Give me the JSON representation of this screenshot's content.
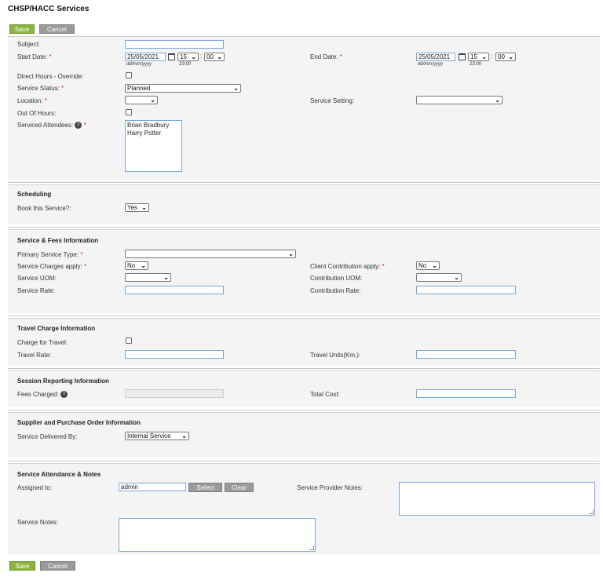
{
  "page": {
    "title": "CHSP/HACC Services"
  },
  "buttons": {
    "save": "Save",
    "cancel": "Cancel",
    "select": "Select",
    "clear": "Clear"
  },
  "required_mark": "*",
  "main": {
    "subject_label": "Subject:",
    "subject_value": "",
    "start_date_label": "Start Date:",
    "start_date_value": "25/05/2021",
    "start_hour": "15",
    "start_minute": "00",
    "date_hint": "dd/mm/yyyy",
    "time_hint": "23:00",
    "time_sep": ":",
    "end_date_label": "End Date:",
    "end_date_value": "25/05/2021",
    "end_hour": "15",
    "end_minute": "00",
    "direct_hours_label": "Direct Hours - Override:",
    "service_status_label": "Service Status:",
    "service_status_value": "Planned",
    "location_label": "Location:",
    "location_value": "",
    "service_setting_label": "Service Setting:",
    "service_setting_value": "",
    "out_of_hours_label": "Out Of Hours:",
    "serviced_attendees_label": "Serviced Attendees:",
    "attendees": [
      "Brian Bradbury",
      "Harry Potter"
    ]
  },
  "scheduling": {
    "title": "Scheduling",
    "book_label": "Book this Service?:",
    "book_value": "Yes"
  },
  "fees": {
    "title": "Service & Fees Information",
    "primary_type_label": "Primary Service Type:",
    "primary_type_value": "",
    "charges_label": "Service Charges apply:",
    "charges_value": "No",
    "client_contrib_label": "Client Contribution apply:",
    "client_contrib_value": "No",
    "uom_label": "Service UOM:",
    "uom_value": "",
    "contrib_uom_label": "Contribution UOM:",
    "contrib_uom_value": "",
    "rate_label": "Service Rate:",
    "rate_value": "",
    "contrib_rate_label": "Contribution Rate:",
    "contrib_rate_value": ""
  },
  "travel": {
    "title": "Travel Charge Information",
    "charge_label": "Charge for Travel:",
    "rate_label": "Travel Rate:",
    "rate_value": "",
    "units_label": "Travel Units(Km.):",
    "units_value": ""
  },
  "session": {
    "title": "Session Reporting Information",
    "fees_label": "Fees Charged:",
    "fees_value": "",
    "total_label": "Total Cost:",
    "total_value": ""
  },
  "supplier": {
    "title": "Supplier and Purchase Order Information",
    "delivered_label": "Service Delivered By:",
    "delivered_value": "Internal Service"
  },
  "attendance": {
    "title": "Service Attendance & Notes",
    "assigned_label": "Assigned to:",
    "assigned_value": "admin",
    "provider_notes_label": "Service Provider Notes:",
    "service_notes_label": "Service Notes:"
  },
  "colors": {
    "save_green": "#8cb43f",
    "cancel_grey": "#9a9a9a",
    "required_red": "#d02020",
    "input_border": "#7aa7d6"
  }
}
